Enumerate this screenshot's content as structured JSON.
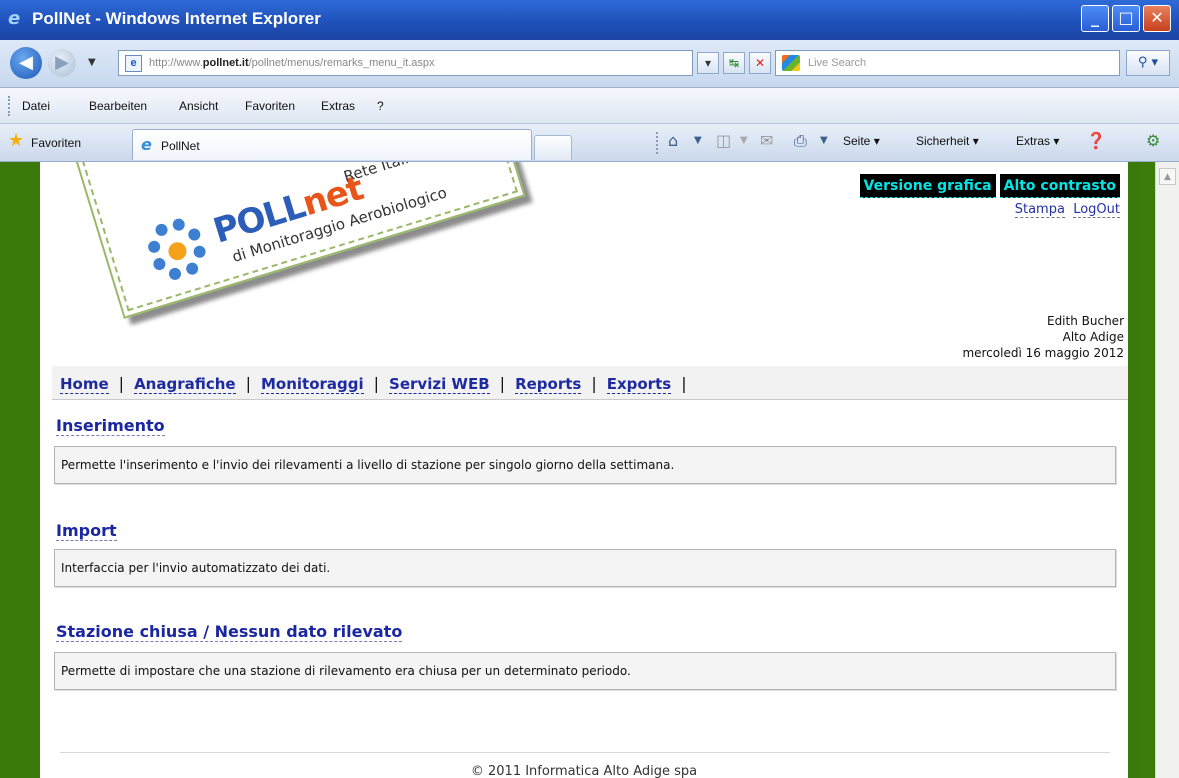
{
  "window": {
    "title": "PollNet - Windows Internet Explorer"
  },
  "address": {
    "url_prefix": "http://www.",
    "url_domain": "pollnet.it",
    "url_path": "/pollnet/menus/remarks_menu_it.aspx",
    "search_placeholder": "Live Search"
  },
  "menubar": {
    "items": [
      "Datei",
      "Bearbeiten",
      "Ansicht",
      "Favoriten",
      "Extras",
      "?"
    ]
  },
  "favbar": {
    "favorites_label": "Favoriten",
    "tab_label": "PollNet",
    "commands": {
      "seite": "Seite",
      "sicherheit": "Sicherheit",
      "extras": "Extras"
    }
  },
  "page": {
    "logo": {
      "name_a": "POLL",
      "name_b": "net",
      "subtitle1": "Rete Italiana",
      "subtitle2": "di Monitoraggio Aerobiologico"
    },
    "contrast": {
      "graphic": "Versione grafica",
      "high": "Alto contrasto"
    },
    "links": {
      "print": "Stampa",
      "logout": "LogOut"
    },
    "user": {
      "name": "Edith Bucher",
      "region": "Alto Adige",
      "date": "mercoledì 16 maggio 2012"
    },
    "nav": [
      "Home",
      "Anagrafiche",
      "Monitoraggi",
      "Servizi WEB",
      "Reports",
      "Exports"
    ],
    "sections": [
      {
        "title": "Inserimento",
        "description": "Permette l'inserimento e l'invio dei rilevamenti a livello di stazione per singolo giorno della settimana."
      },
      {
        "title": "Import",
        "description": "Interfaccia per l'invio automatizzato dei dati."
      },
      {
        "title": "Stazione chiusa / Nessun dato rilevato",
        "description": "Permette di impostare che una stazione di rilevamento era chiusa per un determinato periodo."
      }
    ],
    "footer": "© 2011 Informatica Alto Adige spa"
  },
  "colors": {
    "brand_green": "#3a7a0a",
    "link_blue": "#1e2aa0",
    "contrast_cyan": "#00e5e5"
  }
}
